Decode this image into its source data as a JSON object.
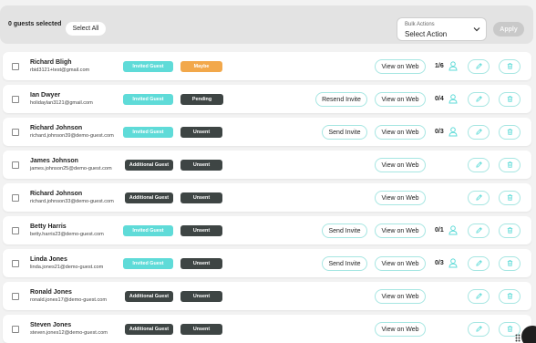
{
  "header": {
    "selected_count": "0 guests selected",
    "select_all_label": "Select All",
    "bulk_actions_label": "Bulk Actions",
    "bulk_actions_value": "Select Action",
    "apply_label": "Apply"
  },
  "actions": {
    "view_label": "View on Web",
    "send_invite_label": "Send Invite",
    "resend_invite_label": "Resend Invite"
  },
  "colors": {
    "accent": "#5fdbd8",
    "dark_badge": "#3e4544",
    "maybe": "#f2a84b"
  },
  "rows": [
    {
      "name": "Richard Bligh",
      "email": "rbid3121+test@gmail.com",
      "type": "Invited Guest",
      "status": "Maybe",
      "invite": "",
      "count": "1/6"
    },
    {
      "name": "Ian Dwyer",
      "email": "holidaylan3121@gmail.com",
      "type": "Invited Guest",
      "status": "Pending",
      "invite": "Resend Invite",
      "count": "0/4"
    },
    {
      "name": "Richard Johnson",
      "email": "richard.johnson39@demo-guest.com",
      "type": "Invited Guest",
      "status": "Unsent",
      "invite": "Send Invite",
      "count": "0/3"
    },
    {
      "name": "James Johnson",
      "email": "james.johnson25@demo-guest.com",
      "type": "Additional Guest",
      "status": "Unsent",
      "invite": "",
      "count": ""
    },
    {
      "name": "Richard Johnson",
      "email": "richard.johnson33@demo-guest.com",
      "type": "Additional Guest",
      "status": "Unsent",
      "invite": "",
      "count": ""
    },
    {
      "name": "Betty Harris",
      "email": "betty.harris23@demo-guest.com",
      "type": "Invited Guest",
      "status": "Unsent",
      "invite": "Send Invite",
      "count": "0/1"
    },
    {
      "name": "Linda Jones",
      "email": "linda.jones21@demo-guest.com",
      "type": "Invited Guest",
      "status": "Unsent",
      "invite": "Send Invite",
      "count": "0/3"
    },
    {
      "name": "Ronald Jones",
      "email": "ronald.jones17@demo-guest.com",
      "type": "Additional Guest",
      "status": "Unsent",
      "invite": "",
      "count": ""
    },
    {
      "name": "Steven Jones",
      "email": "steven.jones12@demo-guest.com",
      "type": "Additional Guest",
      "status": "Unsent",
      "invite": "",
      "count": ""
    }
  ]
}
